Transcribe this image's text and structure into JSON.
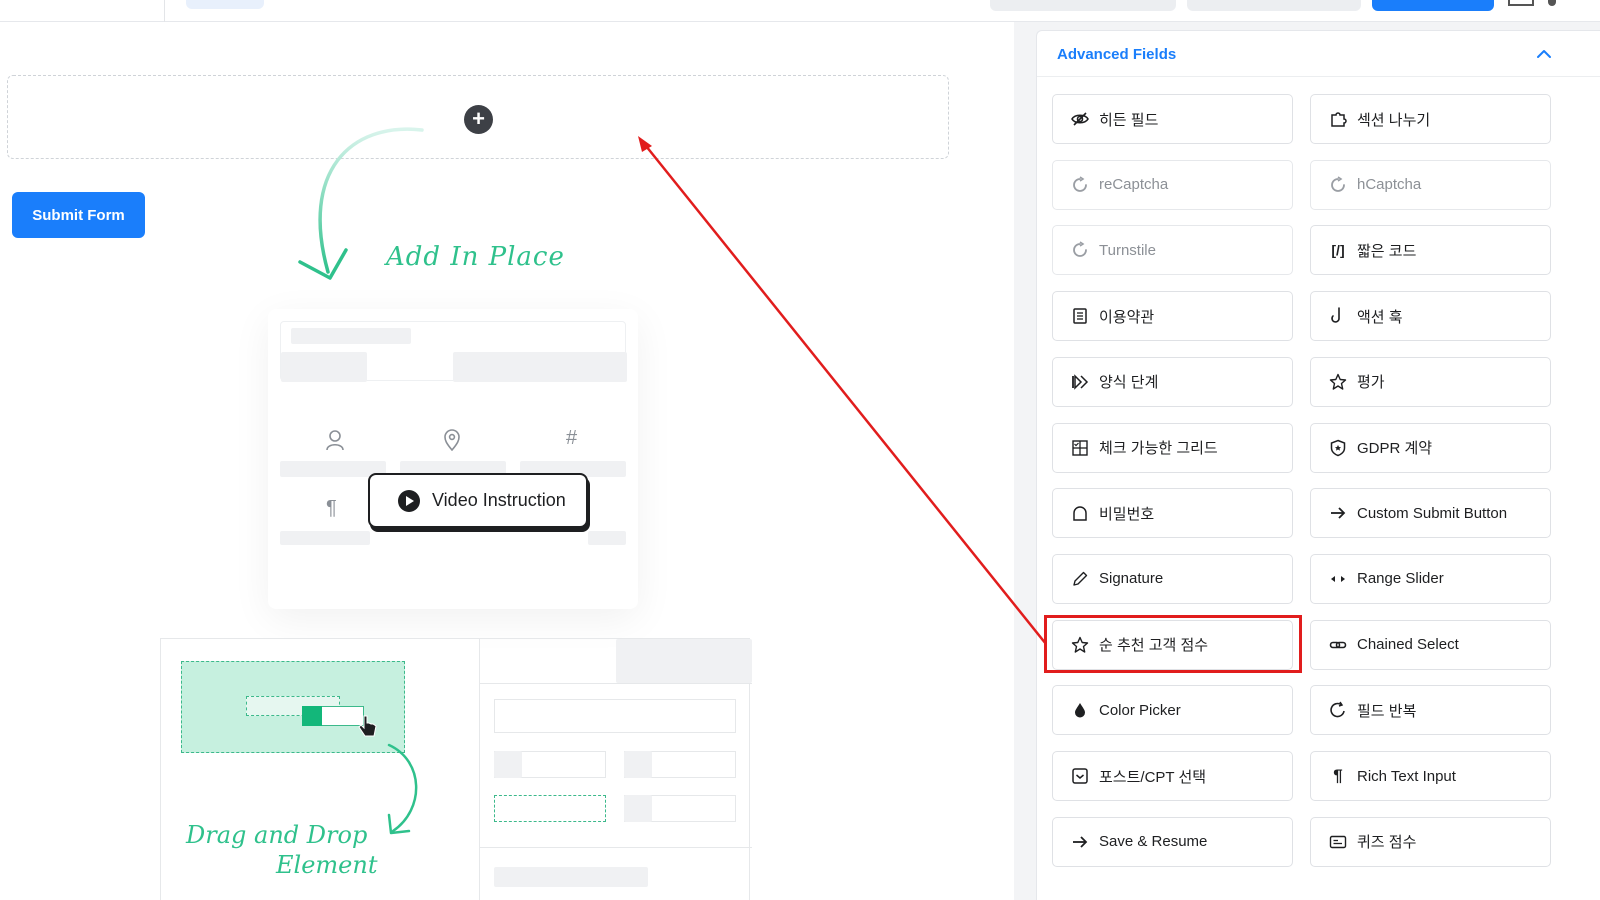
{
  "canvas": {
    "submit_label": "Submit Form",
    "add_in_place": "Add In Place",
    "drag_drop_line1": "Drag and Drop",
    "drag_drop_line2": "Element",
    "video_label": "Video Instruction"
  },
  "sidebar": {
    "title": "Advanced Fields",
    "fields": [
      {
        "label": "히든 필드",
        "icon": "eye-hidden-icon",
        "disabled": false
      },
      {
        "label": "섹션 나누기",
        "icon": "puzzle-icon",
        "disabled": false
      },
      {
        "label": "reCaptcha",
        "icon": "captcha-icon",
        "disabled": true
      },
      {
        "label": "hCaptcha",
        "icon": "captcha-icon",
        "disabled": true
      },
      {
        "label": "Turnstile",
        "icon": "captcha-icon",
        "disabled": true
      },
      {
        "label": "짧은 코드",
        "icon": "shortcode-icon",
        "disabled": false
      },
      {
        "label": "이용약관",
        "icon": "document-icon",
        "disabled": false
      },
      {
        "label": "액션 훅",
        "icon": "hook-icon",
        "disabled": false
      },
      {
        "label": "양식 단계",
        "icon": "steps-icon",
        "disabled": false
      },
      {
        "label": "평가",
        "icon": "star-icon",
        "disabled": false
      },
      {
        "label": "체크 가능한 그리드",
        "icon": "grid-icon",
        "disabled": false
      },
      {
        "label": "GDPR 계약",
        "icon": "shield-icon",
        "disabled": false
      },
      {
        "label": "비밀번호",
        "icon": "lock-icon",
        "disabled": false
      },
      {
        "label": "Custom Submit Button",
        "icon": "arrow-right-icon",
        "disabled": false
      },
      {
        "label": "Signature",
        "icon": "pen-icon",
        "disabled": false
      },
      {
        "label": "Range Slider",
        "icon": "slider-icon",
        "disabled": false
      },
      {
        "label": "순 추천 고객 점수",
        "icon": "star-icon",
        "disabled": false
      },
      {
        "label": "Chained Select",
        "icon": "link-icon",
        "disabled": false
      },
      {
        "label": "Color Picker",
        "icon": "drop-icon",
        "disabled": false
      },
      {
        "label": "필드 반복",
        "icon": "repeat-icon",
        "disabled": false
      },
      {
        "label": "포스트/CPT 선택",
        "icon": "post-icon",
        "disabled": false
      },
      {
        "label": "Rich Text Input",
        "icon": "paragraph-icon",
        "disabled": false
      },
      {
        "label": "Save & Resume",
        "icon": "arrow-right-icon",
        "disabled": false
      },
      {
        "label": "퀴즈 점수",
        "icon": "quiz-icon",
        "disabled": false
      }
    ]
  },
  "colors": {
    "accent": "#1a7efb",
    "highlight": "#e11d1d",
    "handwriting": "#2fc18c"
  }
}
